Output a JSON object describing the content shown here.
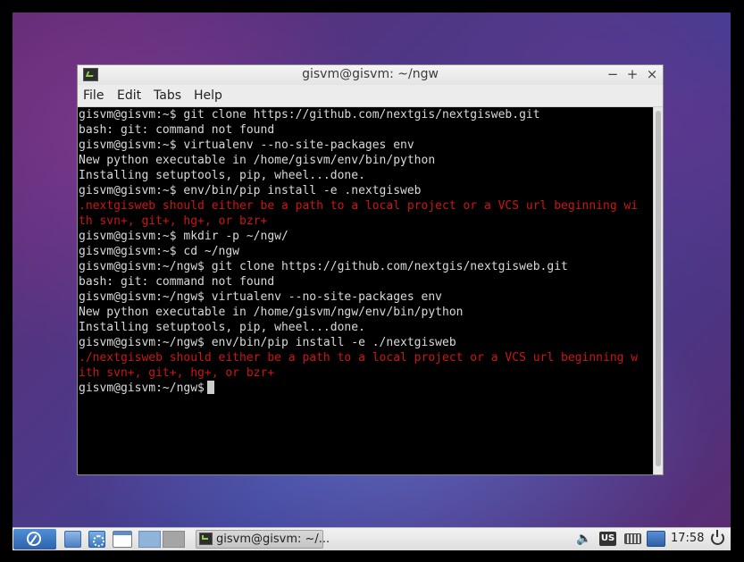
{
  "window": {
    "title": "gisvm@gisvm: ~/ngw",
    "buttons": {
      "minimize": "−",
      "maximize": "+",
      "close": "×"
    }
  },
  "menubar": {
    "items": [
      "File",
      "Edit",
      "Tabs",
      "Help"
    ]
  },
  "terminal": {
    "lines": [
      {
        "text": "gisvm@gisvm:~$ git clone https://github.com/nextgis/nextgisweb.git",
        "type": "normal"
      },
      {
        "text": "bash: git: command not found",
        "type": "normal"
      },
      {
        "text": "gisvm@gisvm:~$ virtualenv --no-site-packages env",
        "type": "normal"
      },
      {
        "text": "New python executable in /home/gisvm/env/bin/python",
        "type": "normal"
      },
      {
        "text": "Installing setuptools, pip, wheel...done.",
        "type": "normal"
      },
      {
        "text": "gisvm@gisvm:~$ env/bin/pip install -e .nextgisweb",
        "type": "normal"
      },
      {
        "text": ".nextgisweb should either be a path to a local project or a VCS url beginning wi",
        "type": "error"
      },
      {
        "text": "th svn+, git+, hg+, or bzr+",
        "type": "error"
      },
      {
        "text": "gisvm@gisvm:~$ mkdir -p ~/ngw/",
        "type": "normal"
      },
      {
        "text": "gisvm@gisvm:~$ cd ~/ngw",
        "type": "normal"
      },
      {
        "text": "gisvm@gisvm:~/ngw$ git clone https://github.com/nextgis/nextgisweb.git",
        "type": "normal"
      },
      {
        "text": "bash: git: command not found",
        "type": "normal"
      },
      {
        "text": "gisvm@gisvm:~/ngw$ virtualenv --no-site-packages env",
        "type": "normal"
      },
      {
        "text": "New python executable in /home/gisvm/ngw/env/bin/python",
        "type": "normal"
      },
      {
        "text": "Installing setuptools, pip, wheel...done.",
        "type": "normal"
      },
      {
        "text": "gisvm@gisvm:~/ngw$ env/bin/pip install -e ./nextgisweb",
        "type": "normal"
      },
      {
        "text": "./nextgisweb should either be a path to a local project or a VCS url beginning w",
        "type": "error"
      },
      {
        "text": "ith svn+, git+, hg+, or bzr+",
        "type": "error"
      }
    ],
    "prompt": "gisvm@gisvm:~/ngw$"
  },
  "taskbar": {
    "start_icon": "lxde-menu-icon",
    "launchers": [
      "file-manager-icon",
      "app-launcher-icon",
      "show-desktop-icon"
    ],
    "task_label": "gisvm@gisvm: ~/...",
    "keyboard_layout": "US",
    "clock": "17:58"
  }
}
